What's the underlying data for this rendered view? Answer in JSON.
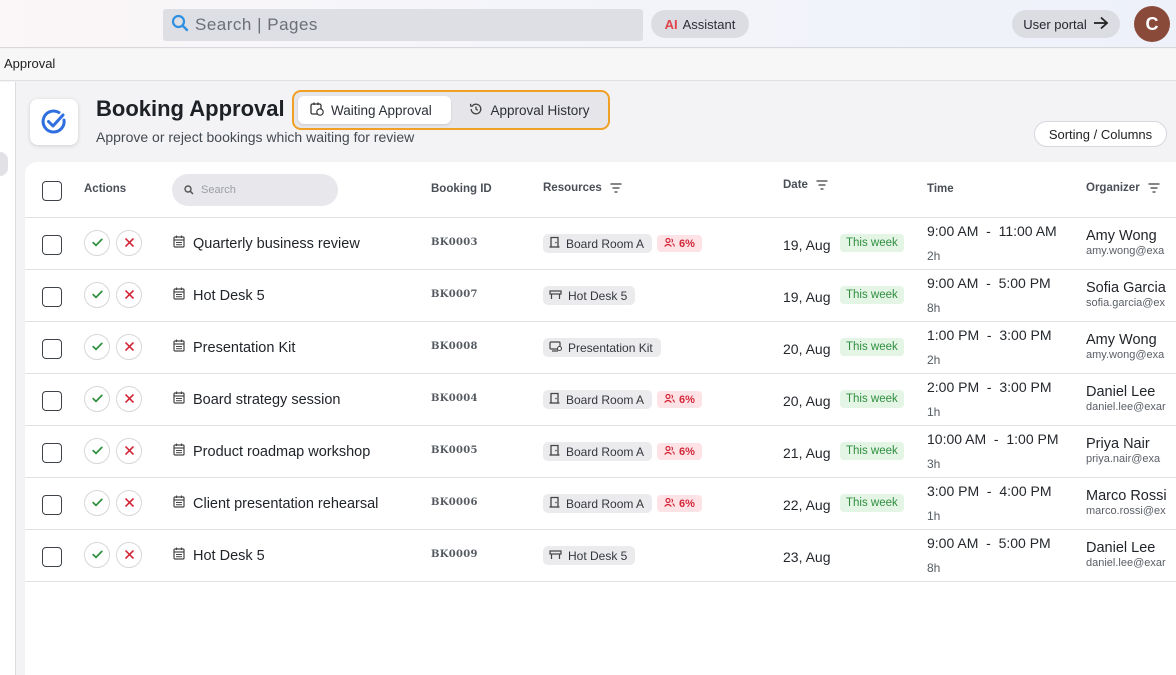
{
  "topbar": {
    "search_placeholder": "Search | Pages",
    "assistant_ai": "AI",
    "assistant_label": "Assistant",
    "user_portal_label": "User portal",
    "avatar_initial": "C"
  },
  "breadcrumb": "Approval",
  "header": {
    "title": "Booking Approval",
    "subtitle": "Approve or reject bookings which waiting for review",
    "tabs": [
      {
        "label": "Waiting Approval",
        "active": true
      },
      {
        "label": "Approval History",
        "active": false
      }
    ],
    "sorting_label": "Sorting / Columns"
  },
  "table": {
    "columns": {
      "actions": "Actions",
      "search_placeholder": "Search",
      "booking_id": "Booking ID",
      "resources": "Resources",
      "date": "Date",
      "time": "Time",
      "organizer": "Organizer"
    },
    "rows": [
      {
        "name": "Quarterly business review",
        "id": "BK0003",
        "resource": "Board Room A",
        "resource_icon": "room-icon",
        "occupancy": "6%",
        "date": "19, Aug",
        "week": "This week",
        "time": "9:00 AM  -  11:00 AM",
        "duration": "2h",
        "organizer": "Amy Wong",
        "email": "amy.wong@exa"
      },
      {
        "name": "Hot Desk 5",
        "id": "BK0007",
        "resource": "Hot Desk 5",
        "resource_icon": "desk-icon",
        "occupancy": "",
        "date": "19, Aug",
        "week": "This week",
        "time": "9:00 AM  -  5:00 PM",
        "duration": "8h",
        "organizer": "Sofia Garcia",
        "email": "sofia.garcia@ex"
      },
      {
        "name": "Presentation Kit",
        "id": "BK0008",
        "resource": "Presentation Kit",
        "resource_icon": "kit-icon",
        "occupancy": "",
        "date": "20, Aug",
        "week": "This week",
        "time": "1:00 PM  -  3:00 PM",
        "duration": "2h",
        "organizer": "Amy Wong",
        "email": "amy.wong@exa"
      },
      {
        "name": "Board strategy session",
        "id": "BK0004",
        "resource": "Board Room A",
        "resource_icon": "room-icon",
        "occupancy": "6%",
        "date": "20, Aug",
        "week": "This week",
        "time": "2:00 PM  -  3:00 PM",
        "duration": "1h",
        "organizer": "Daniel Lee",
        "email": "daniel.lee@exar"
      },
      {
        "name": "Product roadmap workshop",
        "id": "BK0005",
        "resource": "Board Room A",
        "resource_icon": "room-icon",
        "occupancy": "6%",
        "date": "21, Aug",
        "week": "This week",
        "time": "10:00 AM  -  1:00 PM",
        "duration": "3h",
        "organizer": "Priya Nair",
        "email": "priya.nair@exa"
      },
      {
        "name": "Client presentation rehearsal",
        "id": "BK0006",
        "resource": "Board Room A",
        "resource_icon": "room-icon",
        "occupancy": "6%",
        "date": "22, Aug",
        "week": "This week",
        "time": "3:00 PM  -  4:00 PM",
        "duration": "1h",
        "organizer": "Marco Rossi",
        "email": "marco.rossi@ex"
      },
      {
        "name": "Hot Desk 5",
        "id": "BK0009",
        "resource": "Hot Desk 5",
        "resource_icon": "desk-icon",
        "occupancy": "",
        "date": "23, Aug",
        "week": "",
        "time": "9:00 AM  -  5:00 PM",
        "duration": "8h",
        "organizer": "Daniel Lee",
        "email": "daniel.lee@exar"
      }
    ]
  },
  "colors": {
    "accent_orange": "#f0a024",
    "approve_green": "#2f8f3e",
    "reject_red": "#d4283b",
    "brand_blue": "#2f6fe0"
  }
}
